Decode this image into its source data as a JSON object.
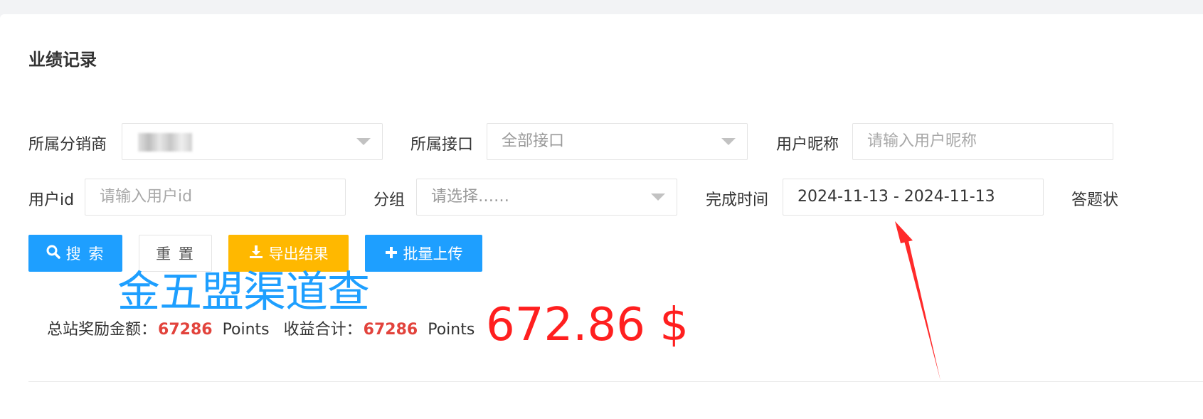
{
  "page_title": "业绩记录",
  "filters": {
    "distributor": {
      "label": "所属分销商",
      "value": ""
    },
    "interface": {
      "label": "所属接口",
      "value": "全部接口"
    },
    "nickname": {
      "label": "用户昵称",
      "placeholder": "请输入用户昵称"
    },
    "user_id": {
      "label": "用户id",
      "placeholder": "请输入用户id"
    },
    "group": {
      "label": "分组",
      "value": "请选择……"
    },
    "finish_time": {
      "label": "完成时间",
      "value": "2024-11-13 - 2024-11-13"
    },
    "answer_status": {
      "label": "答题状"
    }
  },
  "buttons": {
    "search": "搜 索",
    "reset": "重 置",
    "export": "导出结果",
    "batch_upload": "批量上传"
  },
  "overlay_text": "金五盟渠道查",
  "summary": {
    "total_reward_label": "总站奖励金额：",
    "total_reward_value": "67286",
    "total_reward_unit": "Points",
    "income_label": "收益合计：",
    "income_value": "67286",
    "income_unit": "Points"
  },
  "big_amount": "672.86 $",
  "colors": {
    "primary_blue": "#1e9fff",
    "warning_yellow": "#ffb800",
    "highlight_red": "#e2433c",
    "annotation_red": "#ff1f1f"
  },
  "icons": {
    "search": "search-icon",
    "export": "download-icon",
    "batch_upload": "plus-icon",
    "select_caret": "caret-down-icon"
  }
}
